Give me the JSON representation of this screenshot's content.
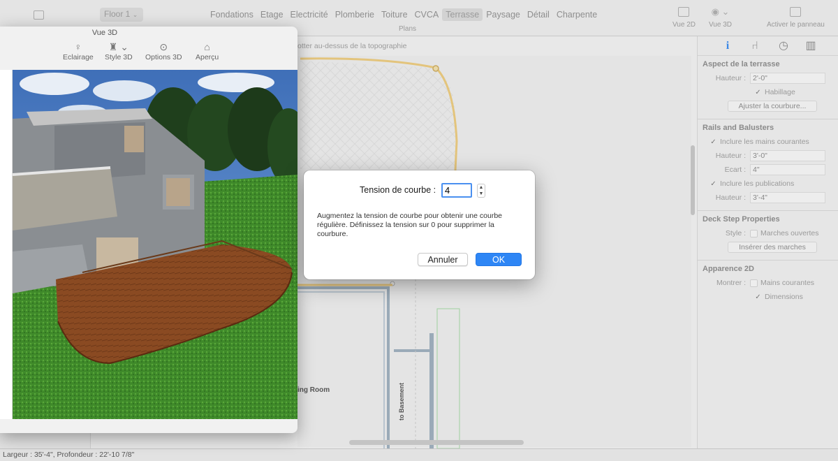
{
  "toolbar": {
    "floor_select": "Floor 1",
    "tabs": [
      "Fondations",
      "Etage",
      "Electricité",
      "Plomberie",
      "Toiture",
      "CVCA",
      "Terrasse",
      "Paysage",
      "Détail",
      "Charpente"
    ],
    "active_tab": "Terrasse",
    "plans_label": "Plans",
    "vue2d_label": "Vue 2D",
    "vue3d_label": "Vue 3D",
    "panel_label": "Activer le panneau"
  },
  "plan": {
    "hint": "otter au-dessus de la topographie",
    "room_living": "ing Room",
    "room_basement": "to Basement"
  },
  "window3d": {
    "title": "Vue 3D",
    "tools": [
      "Eclairage",
      "Style 3D",
      "Options 3D",
      "Aperçu"
    ]
  },
  "right_panel": {
    "deck": {
      "title": "Aspect de la terrasse",
      "height_label": "Hauteur :",
      "height_value": "2'-0\"",
      "habillage": "Habillage",
      "adjust_button": "Ajuster la courbure..."
    },
    "rails": {
      "title": "Rails and Balusters",
      "include_handrails": "Inclure les mains courantes",
      "height_label": "Hauteur :",
      "height_value": "3'-0\"",
      "gap_label": "Ecart :",
      "gap_value": "4\"",
      "include_posts": "Inclure les publications",
      "post_height_label": "Hauteur :",
      "post_height_value": "3'-4\""
    },
    "steps": {
      "title": "Deck Step Properties",
      "style_label": "Style :",
      "open_steps": "Marches ouvertes",
      "insert_button": "Insérer des marches"
    },
    "appearance": {
      "title": "Apparence 2D",
      "show_label": "Montrer :",
      "handrails": "Mains courantes",
      "dimensions": "Dimensions"
    }
  },
  "dialog": {
    "label": "Tension de courbe :",
    "value": "4",
    "description": "Augmentez la tension de courbe pour obtenir une courbe régulière.  Définissez la tension sur 0 pour supprimer la courbure.",
    "cancel": "Annuler",
    "ok": "OK"
  },
  "statusbar": {
    "text": "Largeur : 35'-4\", Profondeur : 22'-10 7/8\""
  }
}
